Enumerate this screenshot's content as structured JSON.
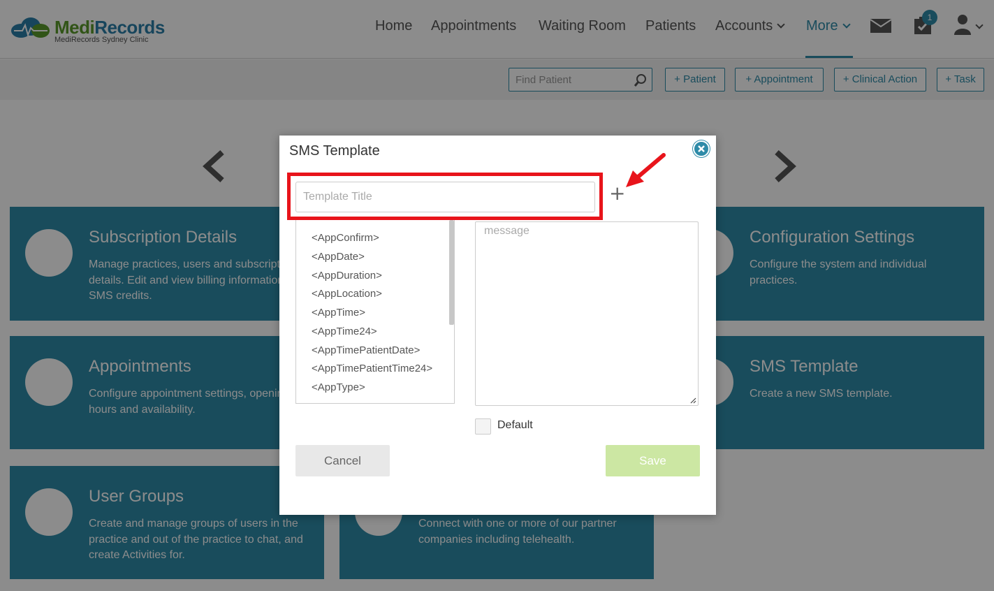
{
  "app": {
    "brand_medi": "Medi",
    "brand_records": "Records",
    "clinic": "MediRecords Sydney Clinic"
  },
  "nav": {
    "home": "Home",
    "appointments": "Appointments",
    "waiting_room": "Waiting Room",
    "patients": "Patients",
    "accounts": "Accounts",
    "more": "More",
    "tasks_badge": "1",
    "icons": [
      "mail-icon",
      "tasks-icon",
      "user-icon"
    ]
  },
  "toolbar": {
    "search_placeholder": "Find Patient",
    "add_patient": "+ Patient",
    "add_appointment": "+ Appointment",
    "add_clinical_action": "+ Clinical Action",
    "add_task": "+ Task"
  },
  "cards": {
    "subscription": {
      "title": "Subscription Details",
      "desc": "Manage practices, users and subscription details. Edit and view billing information. Buy SMS credits."
    },
    "configuration": {
      "title": "Configuration Settings",
      "desc": "Configure the system and individual practices."
    },
    "appointments": {
      "title": "Appointments",
      "desc": "Configure appointment settings, opening hours and availability."
    },
    "sms": {
      "title": "SMS Template",
      "desc": "Create a new SMS template."
    },
    "user_groups": {
      "title": "User Groups",
      "desc": "Create and manage groups of users in the practice and out of the practice to chat, and create Activities for."
    },
    "integrations": {
      "desc": "Connect with one or more of our partner companies including telehealth."
    }
  },
  "modal": {
    "title": "SMS Template",
    "title_placeholder": "Template Title",
    "add_symbol": "+",
    "message_placeholder": "message",
    "default_label": "Default",
    "default_checked": false,
    "cancel": "Cancel",
    "save": "Save",
    "variables": [
      "<AppConfirm>",
      "<AppDate>",
      "<AppDuration>",
      "<AppLocation>",
      "<AppTime>",
      "<AppTime24>",
      "<AppTimePatientDate>",
      "<AppTimePatientTime24>",
      "<AppType>"
    ]
  },
  "colors": {
    "brand_teal": "#2e8ba8",
    "brand_green": "#5a9a2a",
    "save_disabled": "#cce7a3",
    "annotation_red": "#e8141b"
  }
}
